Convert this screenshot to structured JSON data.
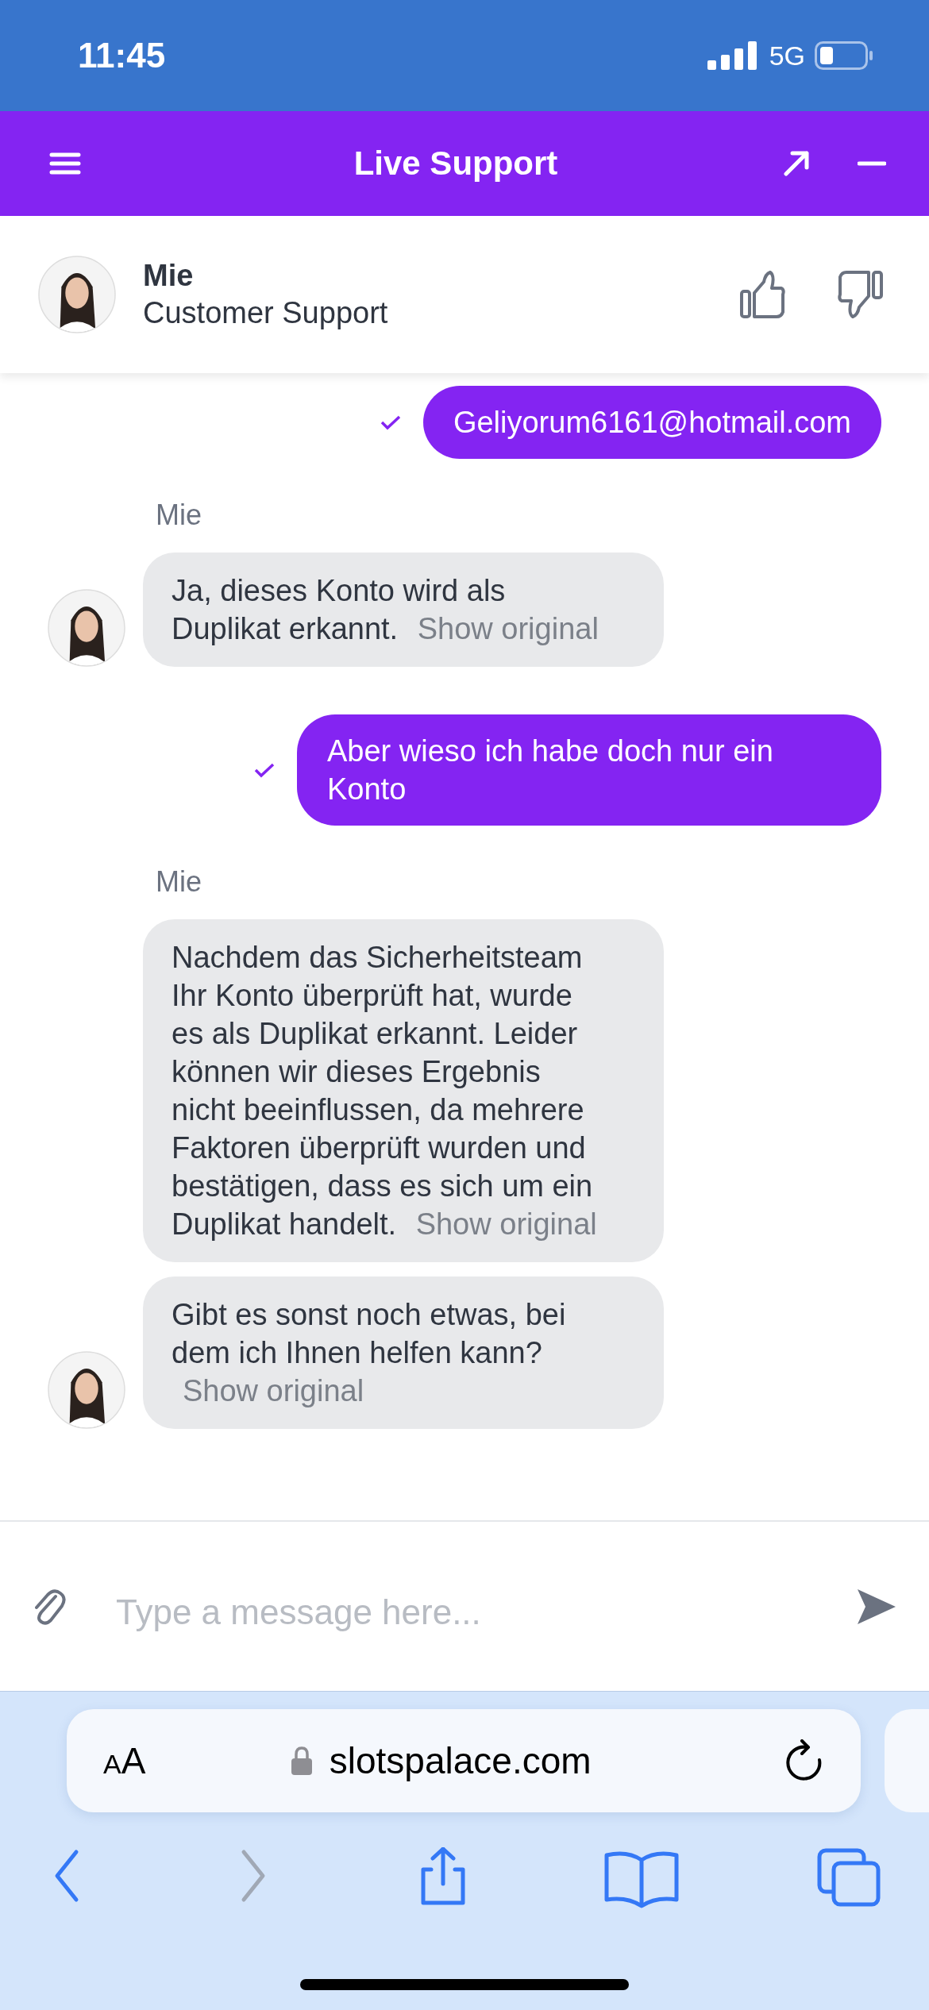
{
  "status_bar": {
    "time": "11:45",
    "network": "5G"
  },
  "header": {
    "title": "Live Support"
  },
  "agent": {
    "name": "Mie",
    "role": "Customer Support"
  },
  "messages": [
    {
      "kind": "outgoing",
      "text": "Geliyorum6161@hotmail.com",
      "delivered": true
    },
    {
      "kind": "sender",
      "text": "Mie"
    },
    {
      "kind": "incoming",
      "text": "Ja, dieses Konto wird als Duplikat erkannt.",
      "link": "Show original",
      "avatar": true
    },
    {
      "kind": "outgoing",
      "text": "Aber wieso ich habe doch nur ein Konto",
      "delivered": true
    },
    {
      "kind": "sender",
      "text": "Mie"
    },
    {
      "kind": "incoming",
      "text": "Nachdem das Sicherheitsteam Ihr Konto überprüft hat, wurde es als Duplikat erkannt. Leider können wir dieses Ergebnis nicht beeinflussen, da mehrere Faktoren überprüft wurden und bestätigen, dass es sich um ein Duplikat handelt.",
      "link": "Show original",
      "avatar": false
    },
    {
      "kind": "incoming",
      "text": "Gibt es sonst noch etwas, bei dem ich Ihnen helfen kann?",
      "link": "Show original",
      "avatar": true
    }
  ],
  "composer": {
    "placeholder": "Type a message here..."
  },
  "browser": {
    "text_size_button": "AA",
    "url": "slotspalace.com",
    "toolbar": [
      {
        "kind": "back",
        "disabled": false
      },
      {
        "kind": "forward",
        "disabled": true
      },
      {
        "kind": "share",
        "disabled": false
      },
      {
        "kind": "bookmarks",
        "disabled": false
      },
      {
        "kind": "tabs",
        "disabled": false
      }
    ]
  }
}
